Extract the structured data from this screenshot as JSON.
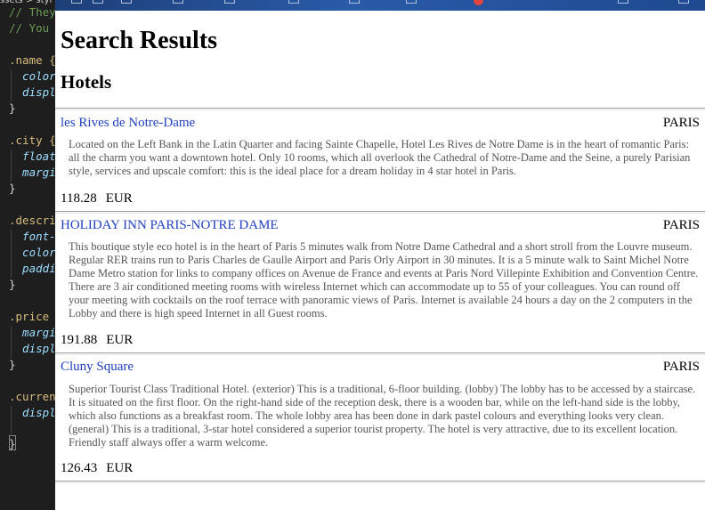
{
  "editor": {
    "breadcrumb": "ssets > styl",
    "lines": [
      {
        "text": "// They",
        "kind": "comment"
      },
      {
        "text": "// You",
        "kind": "comment"
      },
      {
        "text": "",
        "kind": "blank"
      },
      {
        "text": ".name {",
        "kind": "selector"
      },
      {
        "text": "  color",
        "kind": "prop"
      },
      {
        "text": "  displ",
        "kind": "prop"
      },
      {
        "text": "}",
        "kind": "punc"
      },
      {
        "text": "",
        "kind": "blank"
      },
      {
        "text": ".city {",
        "kind": "selector"
      },
      {
        "text": "  float",
        "kind": "prop"
      },
      {
        "text": "  margi",
        "kind": "prop"
      },
      {
        "text": "}",
        "kind": "punc"
      },
      {
        "text": "",
        "kind": "blank"
      },
      {
        "text": ".descri",
        "kind": "selector"
      },
      {
        "text": "  font-",
        "kind": "prop"
      },
      {
        "text": "  color",
        "kind": "prop"
      },
      {
        "text": "  paddi",
        "kind": "prop"
      },
      {
        "text": "}",
        "kind": "punc"
      },
      {
        "text": "",
        "kind": "blank"
      },
      {
        "text": ".price",
        "kind": "selector"
      },
      {
        "text": "  margi",
        "kind": "prop"
      },
      {
        "text": "  displ",
        "kind": "prop"
      },
      {
        "text": "}",
        "kind": "punc"
      },
      {
        "text": "",
        "kind": "blank"
      },
      {
        "text": ".curren",
        "kind": "selector"
      },
      {
        "text": "  displ",
        "kind": "prop"
      },
      {
        "text": "",
        "kind": "blank"
      },
      {
        "text": "}",
        "kind": "punc"
      }
    ]
  },
  "page": {
    "title": "Search Results",
    "section": "Hotels"
  },
  "hotels": [
    {
      "name": "les Rives de Notre-Dame",
      "city": "PARIS",
      "description": "Located on the Left Bank in the Latin Quarter and facing Sainte Chapelle, Hotel Les Rives de Notre Dame is in the heart of romantic Paris: all the charm you want a downtown hotel. Only 10 rooms, which all overlook the Cathedral of Notre-Dame and the Seine, a purely Parisian style, services and upscale comfort: this is the ideal place for a dream holiday in 4 star hotel in Paris.",
      "price": "118.28",
      "currency": "EUR"
    },
    {
      "name": "HOLIDAY INN PARIS-NOTRE DAME",
      "city": "PARIS",
      "description": "This boutique style eco hotel is in the heart of Paris 5 minutes walk from Notre Dame Cathedral and a short stroll from the Louvre museum. Regular RER trains run to Paris Charles de Gaulle Airport and Paris Orly Airport in 30 minutes. It is a 5 minute walk to Saint Michel Notre Dame Metro station for links to company offices on Avenue de France and events at Paris Nord Villepinte Exhibition and Convention Centre. There are 3 air conditioned meeting rooms with wireless Internet which can accommodate up to 55 of your colleagues. You can round off your meeting with cocktails on the roof terrace with panoramic views of Paris. Internet is available 24 hours a day on the 2 computers in the Lobby and there is high speed Internet in all Guest rooms.",
      "price": "191.88",
      "currency": "EUR"
    },
    {
      "name": "Cluny Square",
      "city": "PARIS",
      "description": "Superior Tourist Class Traditional Hotel. (exterior) This is a traditional, 6-floor building. (lobby) The lobby has to be accessed by a staircase. It is situated on the first floor. On the right-hand side of the reception desk, there is a wooden bar, while on the left-hand side is the lobby, which also functions as a breakfast room. The whole lobby area has been done in dark pastel colours and everything looks very clean. (general) This is a traditional, 3-star hotel considered a superior tourist property. The hotel is very attractive, due to its excellent location. Friendly staff always offer a warm welcome.",
      "price": "126.43",
      "currency": "EUR"
    }
  ],
  "colors": {
    "link": "#1f3fbf",
    "description": "#555555",
    "editor_bg": "#1e1e1e",
    "selector": "#d7ba7d",
    "property": "#9cdcfe",
    "comment": "#6a9955"
  }
}
